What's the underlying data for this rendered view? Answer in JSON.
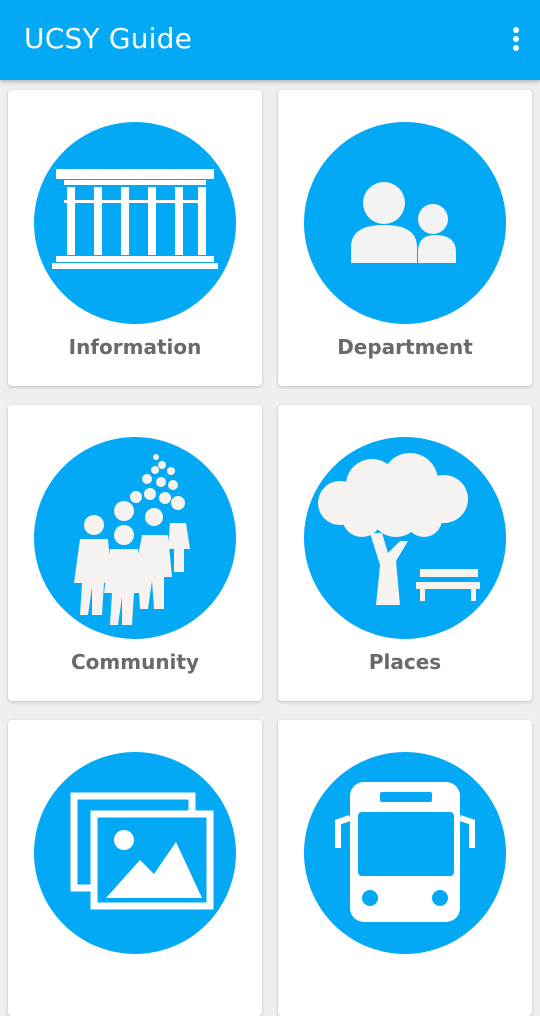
{
  "app": {
    "title": "UCSY Guide"
  },
  "colors": {
    "appbar": "#03a9f4",
    "icon_circle": "#03a9f4",
    "card_background": "#ffffff",
    "label_text": "#6a6a6a",
    "page_background": "#efefef"
  },
  "menu": {
    "icon": "overflow-menu-icon"
  },
  "cards": [
    {
      "label": "Information",
      "icon": "building-columns-icon"
    },
    {
      "label": "Department",
      "icon": "people-icon"
    },
    {
      "label": "Community",
      "icon": "crowd-icon"
    },
    {
      "label": "Places",
      "icon": "tree-bench-icon"
    },
    {
      "label": "",
      "icon": "gallery-photos-icon"
    },
    {
      "label": "",
      "icon": "bus-icon"
    }
  ]
}
